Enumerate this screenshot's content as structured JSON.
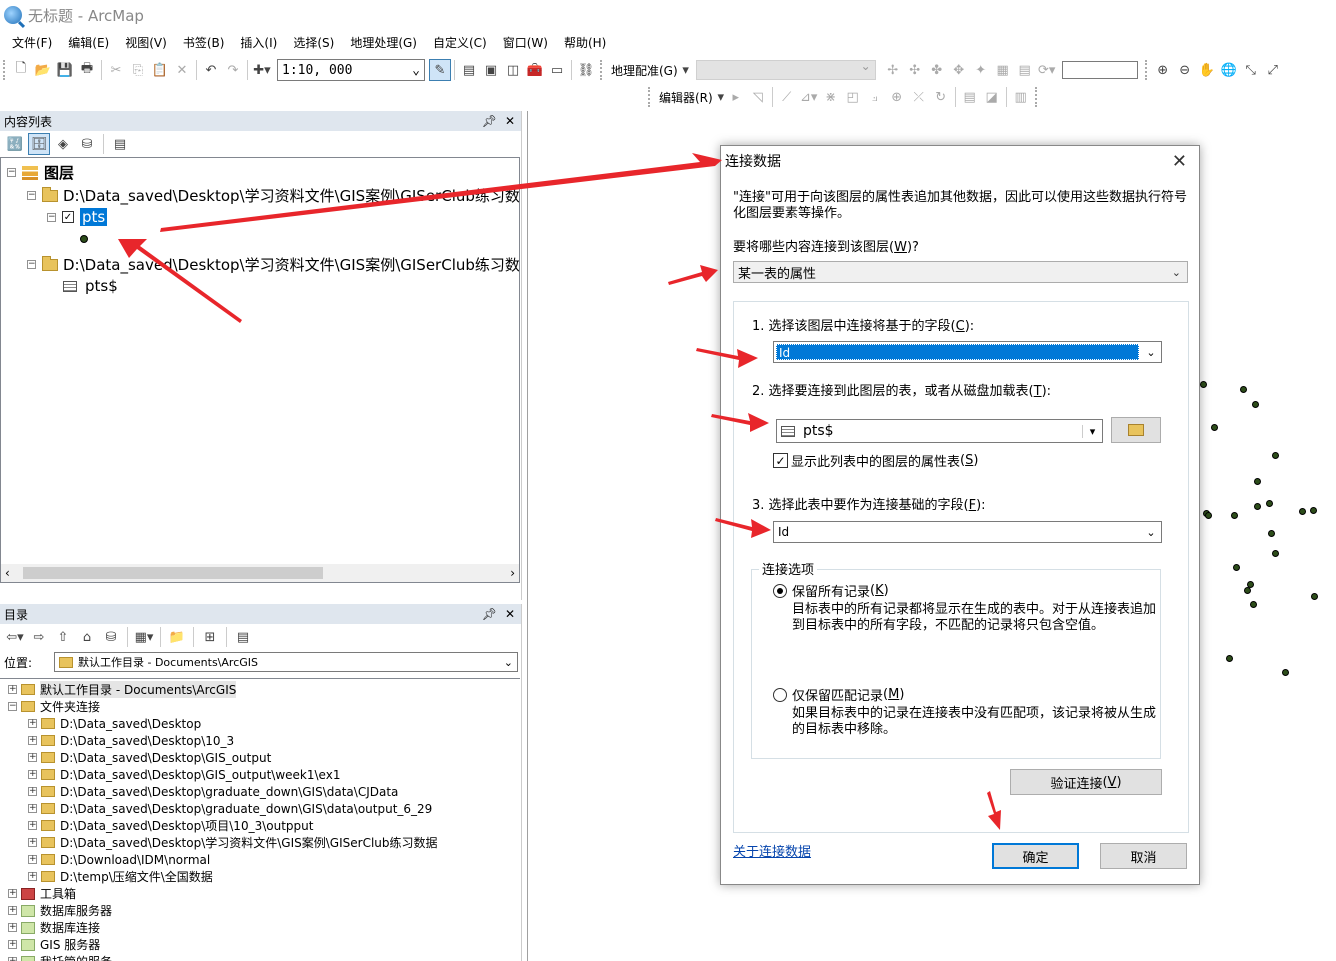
{
  "window": {
    "title": "无标题 - ArcMap"
  },
  "menu": [
    "文件(F)",
    "编辑(E)",
    "视图(V)",
    "书签(B)",
    "插入(I)",
    "选择(S)",
    "地理处理(G)",
    "自定义(C)",
    "窗口(W)",
    "帮助(H)"
  ],
  "toolbar": {
    "scale": "1:10, 000",
    "georef_label": "地理配准(G)",
    "editor_label": "编辑器(R)"
  },
  "toc": {
    "title": "内容列表",
    "root": "图层",
    "folder1": "D:\\Data_saved\\Desktop\\学习资料文件\\GIS案例\\GISerClub练习数据",
    "layer": "pts",
    "folder2": "D:\\Data_saved\\Desktop\\学习资料文件\\GIS案例\\GISerClub练习数据",
    "table": "pts$"
  },
  "catalog": {
    "title": "目录",
    "location_label": "位置:",
    "location_value": "默认工作目录 - Documents\\ArcGIS",
    "items": [
      {
        "label": "默认工作目录 - Documents\\ArcGIS",
        "level": 0,
        "kind": "home"
      },
      {
        "label": "文件夹连接",
        "level": 0,
        "kind": "folder",
        "expanded": true
      },
      {
        "label": "D:\\Data_saved\\Desktop",
        "level": 1,
        "kind": "folder"
      },
      {
        "label": "D:\\Data_saved\\Desktop\\10_3",
        "level": 1,
        "kind": "folder"
      },
      {
        "label": "D:\\Data_saved\\Desktop\\GIS_output",
        "level": 1,
        "kind": "folder"
      },
      {
        "label": "D:\\Data_saved\\Desktop\\GIS_output\\week1\\ex1",
        "level": 1,
        "kind": "folder"
      },
      {
        "label": "D:\\Data_saved\\Desktop\\graduate_down\\GIS\\data\\CJData",
        "level": 1,
        "kind": "folder"
      },
      {
        "label": "D:\\Data_saved\\Desktop\\graduate_down\\GIS\\data\\output_6_29",
        "level": 1,
        "kind": "folder"
      },
      {
        "label": "D:\\Data_saved\\Desktop\\项目\\10_3\\outpput",
        "level": 1,
        "kind": "folder"
      },
      {
        "label": "D:\\Data_saved\\Desktop\\学习资料文件\\GIS案例\\GISerClub练习数据",
        "level": 1,
        "kind": "folder"
      },
      {
        "label": "D:\\Download\\IDM\\normal",
        "level": 1,
        "kind": "folder"
      },
      {
        "label": "D:\\temp\\压缩文件\\全国数据",
        "level": 1,
        "kind": "folder"
      },
      {
        "label": "工具箱",
        "level": 0,
        "kind": "toolbox"
      },
      {
        "label": "数据库服务器",
        "level": 0,
        "kind": "db"
      },
      {
        "label": "数据库连接",
        "level": 0,
        "kind": "db"
      },
      {
        "label": "GIS 服务器",
        "level": 0,
        "kind": "db"
      },
      {
        "label": "我托管的服务",
        "level": 0,
        "kind": "db"
      }
    ]
  },
  "dialog": {
    "title": "连接数据",
    "description": "\"连接\"可用于向该图层的属性表追加其他数据，因此可以使用这些数据执行符号化图层要素等操作。",
    "question_text": "要将哪些内容连接到该图层",
    "question_key": "W",
    "join_type": "某一表的属性",
    "step1_text": "1. 选择该图层中连接将基于的字段",
    "step1_key": "C",
    "step1_value": "Id",
    "step2_text": "2. 选择要连接到此图层的表，或者从磁盘加载表",
    "step2_key": "T",
    "step2_value": "pts$",
    "show_attr_text": "显示此列表中的图层的属性表",
    "show_attr_key": "S",
    "show_attr_checked": true,
    "step3_text": "3. 选择此表中要作为连接基础的字段",
    "step3_key": "F",
    "step3_value": "Id",
    "options_title": "连接选项",
    "keep_all_text": "保留所有记录",
    "keep_all_key": "K",
    "keep_all_desc": "目标表中的所有记录都将显示在生成的表中。对于从连接表追加到目标表中的所有字段，不匹配的记录将只包含空值。",
    "keep_match_text": "仅保留匹配记录",
    "keep_match_key": "M",
    "keep_match_desc": "如果目标表中的记录在连接表中没有匹配项，该记录将被从生成的目标表中移除。",
    "validate_text": "验证连接",
    "validate_key": "V",
    "about_link": "关于连接数据",
    "ok": "确定",
    "cancel": "取消"
  },
  "colors": {
    "selection": "#0078d7",
    "annotation_arrow": "#e8262b",
    "point_fill": "#2d4d1a"
  }
}
